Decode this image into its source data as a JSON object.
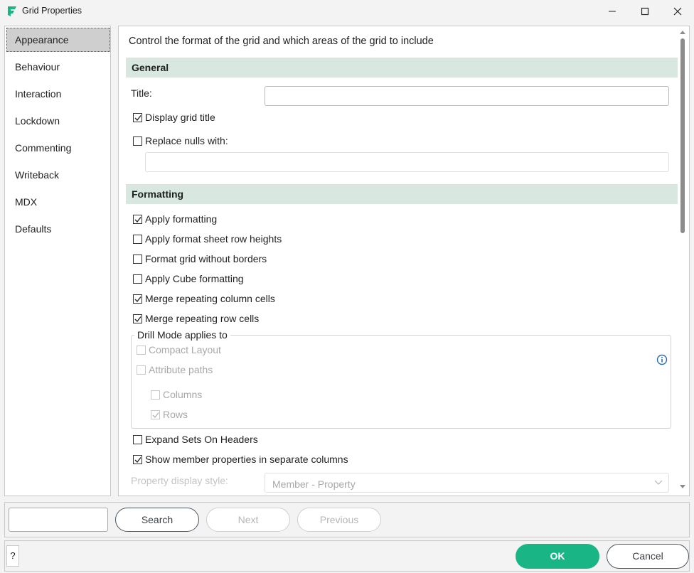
{
  "window": {
    "title": "Grid Properties",
    "icons": {
      "app": "fluence-logo-icon",
      "minimize": "minimize-icon",
      "maximize": "maximize-icon",
      "close": "close-icon"
    }
  },
  "sidebar": {
    "items": [
      {
        "label": "Appearance",
        "active": true
      },
      {
        "label": "Behaviour"
      },
      {
        "label": "Interaction"
      },
      {
        "label": "Lockdown"
      },
      {
        "label": "Commenting"
      },
      {
        "label": "Writeback"
      },
      {
        "label": "MDX"
      },
      {
        "label": "Defaults"
      }
    ]
  },
  "main": {
    "description": "Control the format of the grid and which areas of the grid to include",
    "general": {
      "heading": "General",
      "title_label": "Title:",
      "title_value": "",
      "display_grid_title": {
        "label": "Display grid title",
        "checked": true
      },
      "replace_nulls": {
        "label": "Replace nulls with:",
        "checked": false
      },
      "replace_nulls_value": ""
    },
    "formatting": {
      "heading": "Formatting",
      "apply_formatting": {
        "label": "Apply formatting",
        "checked": true
      },
      "apply_row_heights": {
        "label": "Apply format sheet row heights",
        "checked": false
      },
      "without_borders": {
        "label": "Format grid without borders",
        "checked": false
      },
      "cube_formatting": {
        "label": "Apply Cube formatting",
        "checked": false
      },
      "merge_columns": {
        "label": "Merge repeating column cells",
        "checked": true
      },
      "merge_rows": {
        "label": "Merge repeating row cells",
        "checked": true
      },
      "drill_mode": {
        "legend": "Drill Mode applies to",
        "compact_layout": {
          "label": "Compact Layout",
          "checked": false,
          "disabled": true
        },
        "attribute_paths": {
          "label": "Attribute paths",
          "checked": false,
          "disabled": true
        },
        "columns": {
          "label": "Columns",
          "checked": false,
          "disabled": true
        },
        "rows": {
          "label": "Rows",
          "checked": true,
          "disabled": true
        },
        "info_icon": "info-icon"
      },
      "expand_sets": {
        "label": "Expand Sets On Headers",
        "checked": false
      },
      "member_properties": {
        "label": "Show member properties in separate columns",
        "checked": true
      },
      "property_style_label": "Property display style:",
      "property_style_value": "Member - Property"
    }
  },
  "search": {
    "input_value": "",
    "search_label": "Search",
    "next_label": "Next",
    "previous_label": "Previous"
  },
  "footer": {
    "help_label": "?",
    "ok_label": "OK",
    "cancel_label": "Cancel"
  },
  "colors": {
    "accent": "#1ab585",
    "section_header": "#d8e8e0",
    "selected_nav": "#cfcfcf"
  }
}
